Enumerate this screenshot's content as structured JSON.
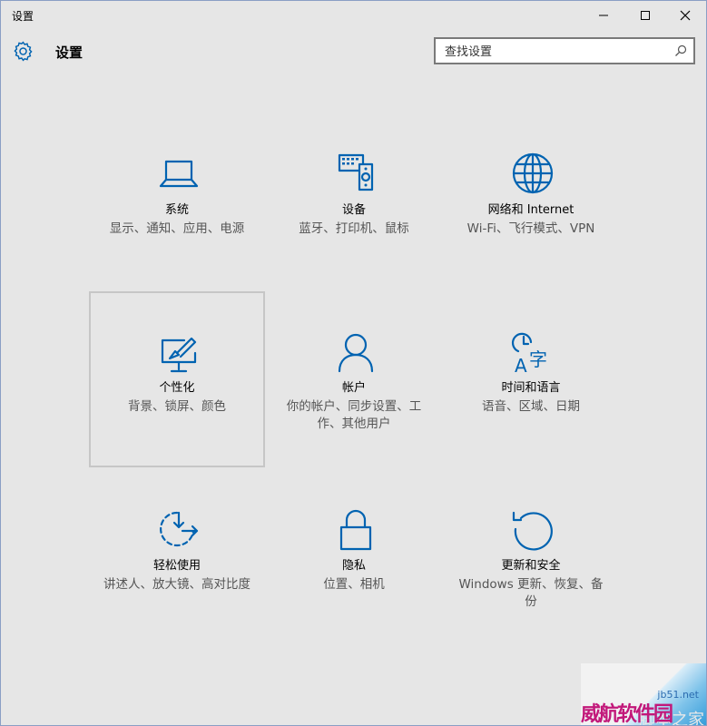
{
  "window": {
    "title": "设置",
    "minimize": "—",
    "maximize": "☐",
    "close": "✕"
  },
  "header": {
    "title": "设置",
    "icon": "gear-icon"
  },
  "search": {
    "placeholder": "查找设置",
    "icon": "search-icon"
  },
  "tiles": [
    {
      "title": "系统",
      "desc": "显示、通知、应用、电源",
      "icon": "laptop-icon"
    },
    {
      "title": "设备",
      "desc": "蓝牙、打印机、鼠标",
      "icon": "devices-icon"
    },
    {
      "title": "网络和 Internet",
      "desc": "Wi-Fi、飞行模式、VPN",
      "icon": "globe-icon"
    },
    {
      "title": "个性化",
      "desc": "背景、锁屏、颜色",
      "icon": "personalization-icon",
      "selected": true
    },
    {
      "title": "帐户",
      "desc": "你的帐户、同步设置、工作、其他用户",
      "icon": "person-icon"
    },
    {
      "title": "时间和语言",
      "desc": "语音、区域、日期",
      "icon": "time-language-icon"
    },
    {
      "title": "轻松使用",
      "desc": "讲述人、放大镜、高对比度",
      "icon": "ease-of-access-icon"
    },
    {
      "title": "隐私",
      "desc": "位置、相机",
      "icon": "lock-icon"
    },
    {
      "title": "更新和安全",
      "desc": "Windows 更新、恢复、备份",
      "icon": "update-icon"
    }
  ],
  "watermark": {
    "site": "jb51.net",
    "brand": "威航软件园",
    "sub": "脚本之家"
  },
  "colors": {
    "accent": "#0063b1",
    "background": "#e6e6e6",
    "selected_border": "#c6c6c6"
  }
}
